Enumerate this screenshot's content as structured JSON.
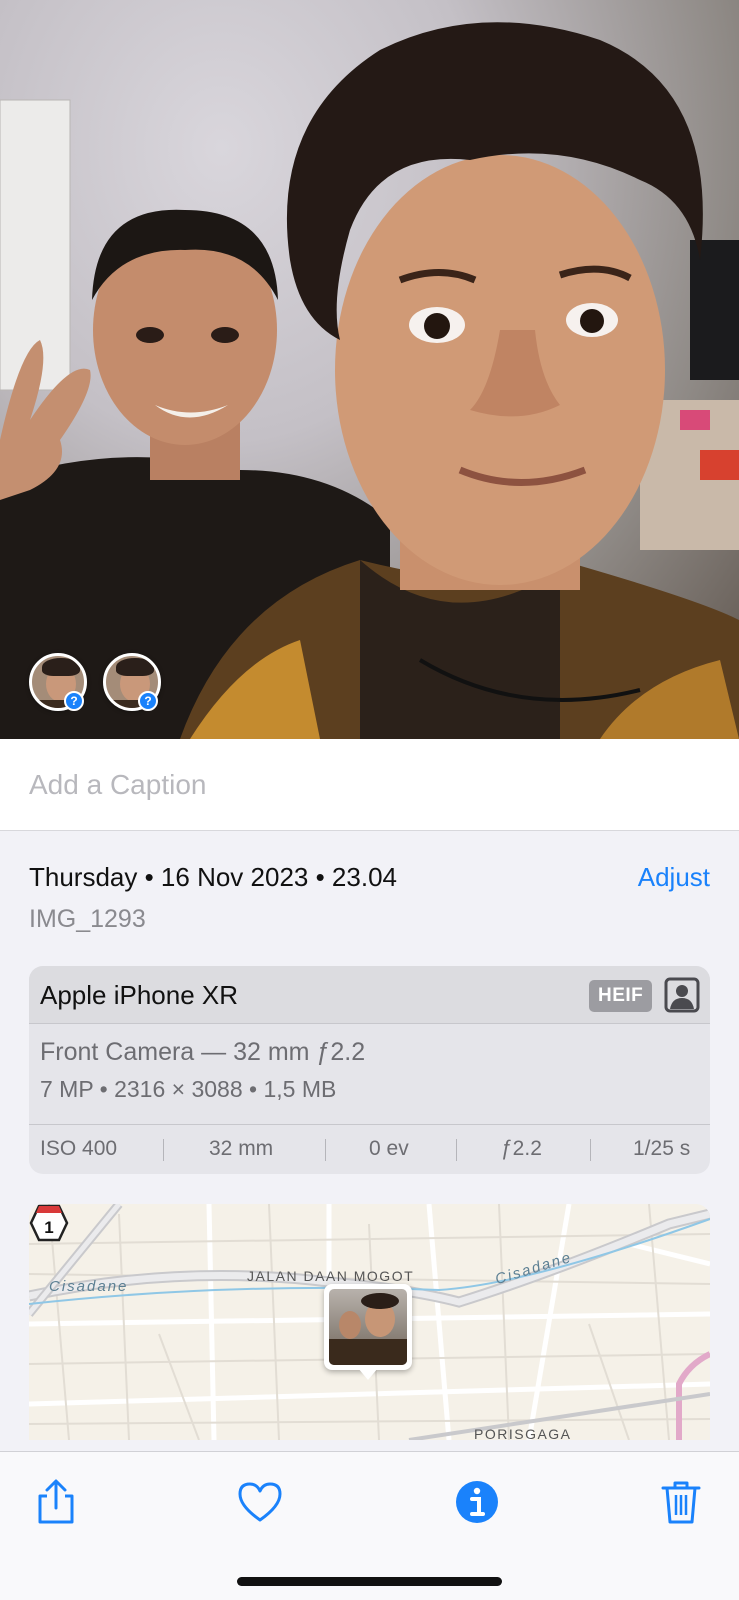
{
  "photo": {
    "people_chips": [
      {
        "badge": "?"
      },
      {
        "badge": "?"
      }
    ]
  },
  "caption": {
    "placeholder": "Add a Caption"
  },
  "meta": {
    "date_line": "Thursday • 16 Nov 2023 • 23.04",
    "adjust_label": "Adjust",
    "filename": "IMG_1293"
  },
  "device": {
    "name": "Apple iPhone XR",
    "format_badge": "HEIF",
    "portrait_icon": "person-portrait-icon",
    "lens": "Front Camera — 32 mm ƒ2.2",
    "specs": "7 MP  •  2316 × 3088  •  1,5 MB",
    "exif": {
      "iso": "ISO 400",
      "focal": "32 mm",
      "ev": "0 ev",
      "aperture": "ƒ2.2",
      "shutter": "1/25 s"
    }
  },
  "map": {
    "labels": {
      "river_left": "Cisadane",
      "river_right": "Cisadane",
      "road": "JALAN DAAN MOGOT",
      "area": "PORISGAGA"
    },
    "route_shield": "1"
  },
  "toolbar": {
    "share_icon": "share-icon",
    "favorite_icon": "heart-icon",
    "info_icon": "info-icon",
    "delete_icon": "trash-icon",
    "accent_color": "#1a82fb"
  }
}
